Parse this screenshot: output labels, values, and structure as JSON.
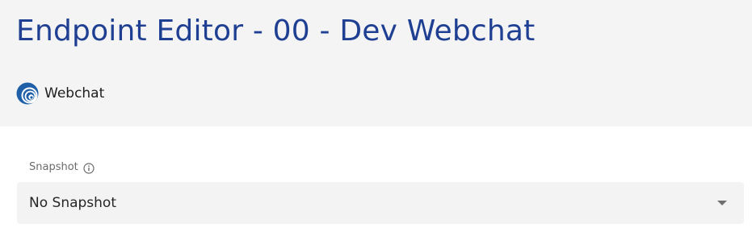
{
  "header": {
    "title": "Endpoint Editor - 00 - Dev Webchat",
    "channel": {
      "label": "Webchat",
      "icon": "webchat-logo-icon",
      "icon_color": "#1f5fa8"
    }
  },
  "form": {
    "snapshot": {
      "label": "Snapshot",
      "info_icon": "info-icon",
      "selected_value": "No Snapshot",
      "dropdown_icon": "chevron-down-icon"
    }
  },
  "colors": {
    "title": "#1f3f93",
    "header_bg": "#f4f4f4",
    "field_bg": "#f3f3f3"
  }
}
